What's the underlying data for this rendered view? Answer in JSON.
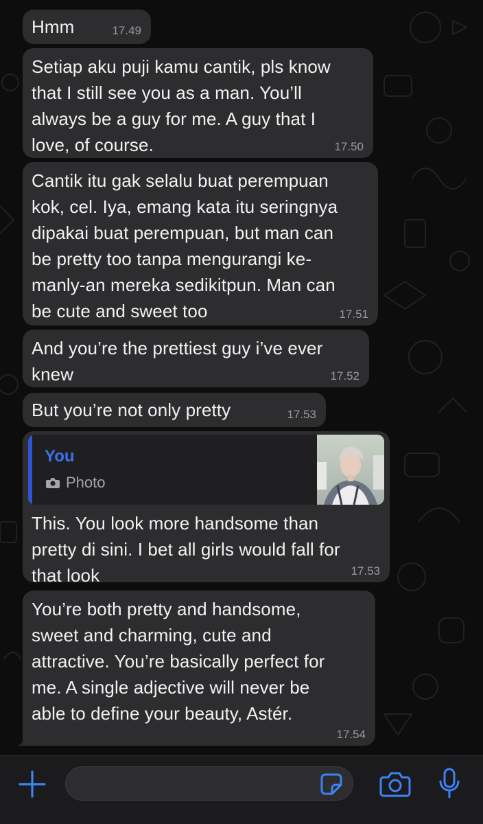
{
  "messages": [
    {
      "text": "Hmm",
      "time": "17.49"
    },
    {
      "text": "Setiap aku puji kamu cantik, pls know\nthat I still see you as a man. You’ll\nalways be a guy for me. A guy that I\nlove, of course.",
      "time": "17.50"
    },
    {
      "text": "Cantik itu gak selalu buat perempuan\nkok, cel. Iya, emang kata itu seringnya\ndipakai buat perempuan, but man can\nbe pretty too tanpa mengurangi ke-\nmanly-an mereka sedikitpun. Man can\nbe cute and sweet too",
      "time": "17.51"
    },
    {
      "text": "And you’re the prettiest guy i’ve ever\nknew",
      "time": "17.52"
    },
    {
      "text": "But you’re not only pretty",
      "time": "17.53"
    },
    {
      "reply": {
        "author": "You",
        "kind": "Photo",
        "kind_icon": "camera-icon"
      },
      "text": "This. You look more handsome than\npretty di sini. I bet all girls would fall for\nthat look",
      "time": "17.53"
    },
    {
      "text": "You’re both pretty and handsome,\nsweet and charming, cute and\nattractive. You’re basically perfect for\nme. A single adjective will never be\nable to define your beauty, Astér.",
      "time": "17.54"
    }
  ],
  "composer": {
    "value": "",
    "icons": [
      "plus-icon",
      "sticker-icon",
      "camera-icon",
      "microphone-icon"
    ]
  },
  "colors": {
    "background": "#0d0d0d",
    "bubble": "#2d2d2f",
    "accent": "#3d6ff0",
    "timestamp": "#9a9a9e"
  }
}
